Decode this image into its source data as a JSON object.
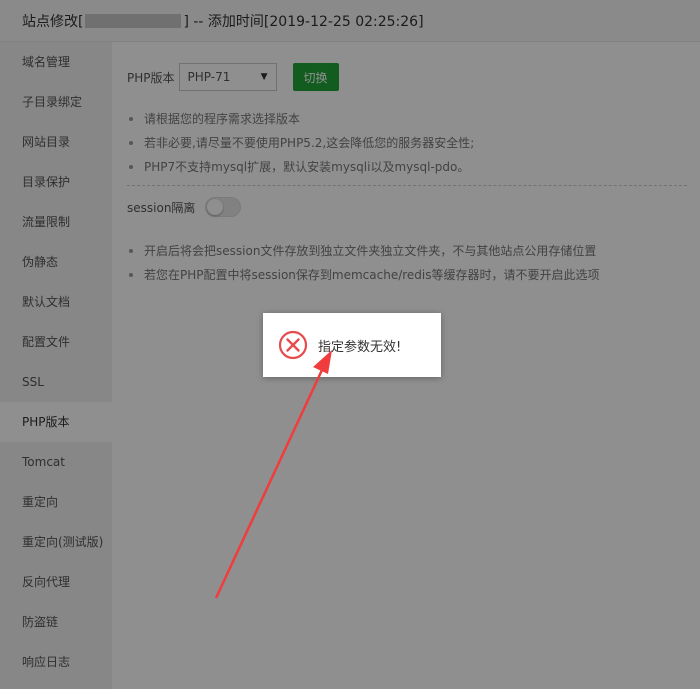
{
  "title": {
    "prefix": "站点修改[",
    "suffix": "] -- 添加时间[2019-12-25 02:25:26]"
  },
  "sidebar": {
    "items": [
      {
        "label": "域名管理"
      },
      {
        "label": "子目录绑定"
      },
      {
        "label": "网站目录"
      },
      {
        "label": "目录保护"
      },
      {
        "label": "流量限制"
      },
      {
        "label": "伪静态"
      },
      {
        "label": "默认文档"
      },
      {
        "label": "配置文件"
      },
      {
        "label": "SSL"
      },
      {
        "label": "PHP版本",
        "active": true
      },
      {
        "label": "Tomcat"
      },
      {
        "label": "重定向"
      },
      {
        "label": "重定向(测试版)"
      },
      {
        "label": "反向代理"
      },
      {
        "label": "防盗链"
      },
      {
        "label": "响应日志"
      }
    ]
  },
  "php": {
    "label": "PHP版本",
    "selected": "PHP-71",
    "switch_label": "切换",
    "tips": [
      "请根据您的程序需求选择版本",
      "若非必要,请尽量不要使用PHP5.2,这会降低您的服务器安全性;",
      "PHP7不支持mysql扩展，默认安装mysqli以及mysql-pdo。"
    ]
  },
  "session": {
    "label": "session隔离",
    "enabled": false,
    "tips": [
      "开启后将会把session文件存放到独立文件夹独立文件夹，不与其他站点公用存储位置",
      "若您在PHP配置中将session保存到memcache/redis等缓存器时，请不要开启此选项"
    ]
  },
  "toast": {
    "icon": "error-x-icon",
    "message": "指定参数无效!"
  },
  "colors": {
    "accent": "#20a53a",
    "error": "#e64c4c",
    "annotation_arrow": "#f03c3c"
  }
}
